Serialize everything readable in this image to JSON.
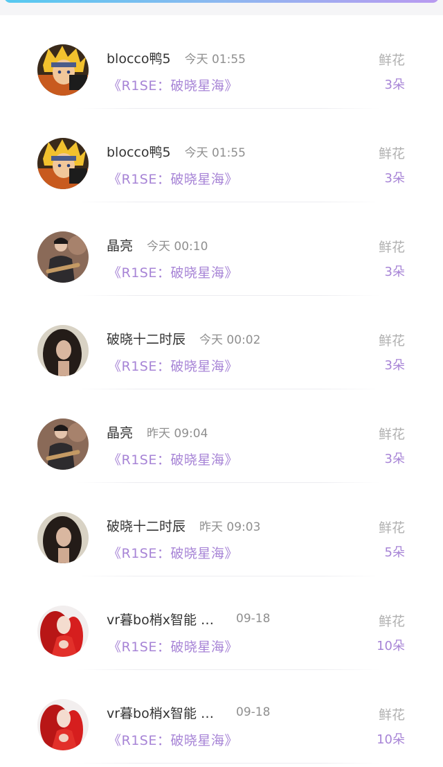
{
  "colors": {
    "accent_purple": "#a784d6",
    "gray_text": "#8f8f8f",
    "name_text": "#333333",
    "top_bar_gradient": [
      "#56c9f0",
      "#b99af0"
    ]
  },
  "items": [
    {
      "name": "blocco鸭5",
      "time": "今天 01:55",
      "book": "《R1SE：破晓星海》",
      "gift_label": "鲜花",
      "gift_count": "3朵",
      "avatar": "naruto-avatar"
    },
    {
      "name": "blocco鸭5",
      "time": "今天 01:55",
      "book": "《R1SE：破晓星海》",
      "gift_label": "鲜花",
      "gift_count": "3朵",
      "avatar": "naruto-avatar"
    },
    {
      "name": "晶亮",
      "time": "今天 00:10",
      "book": "《R1SE：破晓星海》",
      "gift_label": "鲜花",
      "gift_count": "3朵",
      "avatar": "guitar-man-avatar"
    },
    {
      "name": "破晓十二时辰",
      "time": "今天 00:02",
      "book": "《R1SE：破晓星海》",
      "gift_label": "鲜花",
      "gift_count": "3朵",
      "avatar": "woman-avatar"
    },
    {
      "name": "晶亮",
      "time": "昨天 09:04",
      "book": "《R1SE：破晓星海》",
      "gift_label": "鲜花",
      "gift_count": "3朵",
      "avatar": "guitar-man-avatar"
    },
    {
      "name": "破晓十二时辰",
      "time": "昨天 09:03",
      "book": "《R1SE：破晓星海》",
      "gift_label": "鲜花",
      "gift_count": "5朵",
      "avatar": "woman-avatar"
    },
    {
      "name": "vr暮bo梢x智能 …",
      "time": "09-18",
      "book": "《R1SE：破晓星海》",
      "gift_label": "鲜花",
      "gift_count": "10朵",
      "avatar": "red-dress-avatar"
    },
    {
      "name": "vr暮bo梢x智能 …",
      "time": "09-18",
      "book": "《R1SE：破晓星海》",
      "gift_label": "鲜花",
      "gift_count": "10朵",
      "avatar": "red-dress-avatar"
    }
  ]
}
